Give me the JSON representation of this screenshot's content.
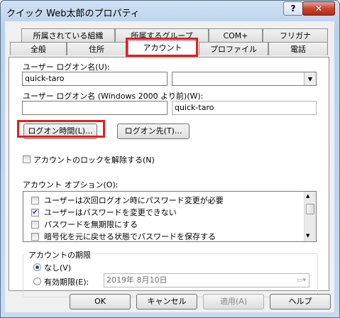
{
  "window": {
    "title": "クイック Web太郎のプロパティ",
    "help_label": "?",
    "close_label": "✕"
  },
  "tabs_row1": [
    "所属されている組織",
    "所属するグループ",
    "COM+",
    "フリガナ"
  ],
  "tabs_row2": [
    "全般",
    "住所",
    "アカウント",
    "プロファイル",
    "電話"
  ],
  "account": {
    "logon_name_label": "ユーザー ログオン名(U):",
    "logon_name_value": "quick-taro",
    "domain_value": "",
    "pre2000_label": "ユーザー ログオン名 (Windows 2000 より前)(W):",
    "pre2000_domain_value": "",
    "pre2000_user_value": "quick-taro",
    "logon_hours_button": "ログオン時間(L)...",
    "logon_to_button": "ログオン先(T)...",
    "unlock_label": "アカウントのロックを解除する(N)",
    "options_label": "アカウント オプション(O):",
    "options": [
      {
        "label": "ユーザーは次回ログオン時にパスワード変更が必要",
        "checked": false
      },
      {
        "label": "ユーザーはパスワードを変更できない",
        "checked": true
      },
      {
        "label": "パスワードを無期限にする",
        "checked": false
      },
      {
        "label": "暗号化を元に戻せる状態でパスワードを保存する",
        "checked": false
      }
    ],
    "expiry_group_label": "アカウントの期限",
    "expiry_never": "なし(V)",
    "expiry_end": "有効期限(E):",
    "expiry_date": "2019年  8月10日"
  },
  "footer": {
    "ok": "OK",
    "cancel": "キャンセル",
    "apply": "適用(A)",
    "help": "ヘルプ"
  },
  "colors": {
    "highlight": "#e02020",
    "title_bg": "#c6daf0",
    "close_red": "#c9452f"
  }
}
